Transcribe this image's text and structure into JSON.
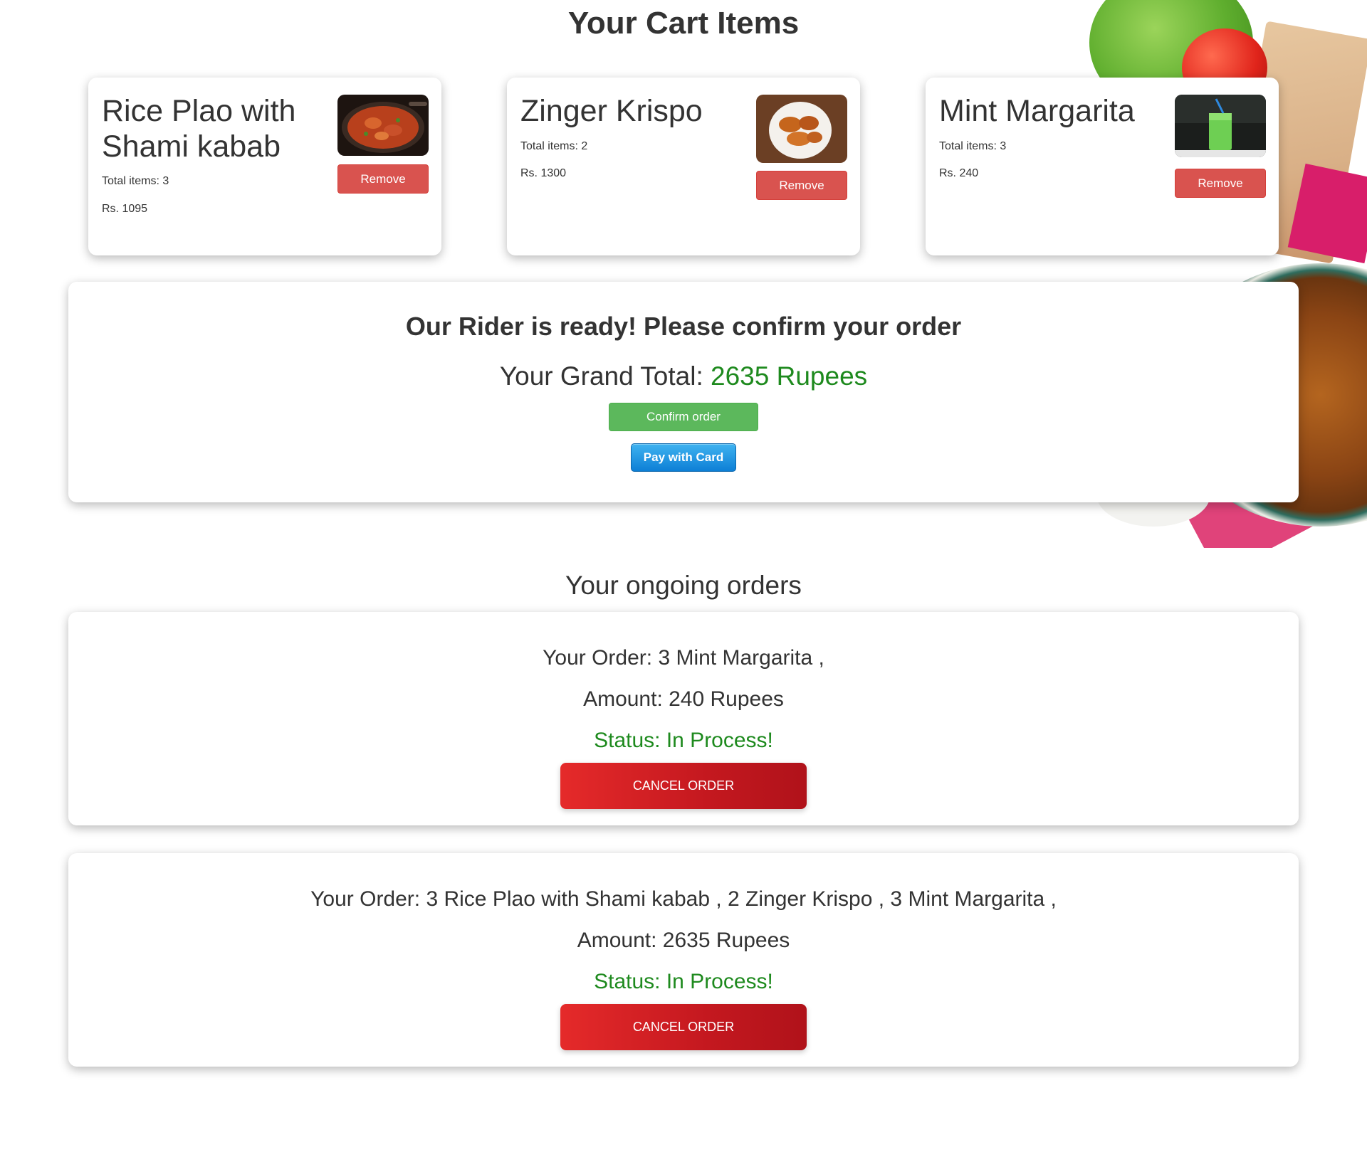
{
  "cart": {
    "title": "Your Cart Items",
    "items": [
      {
        "name": "Rice Plao with Shami kabab",
        "total_items": "Total items: 3",
        "price": "Rs. 1095",
        "remove_label": "Remove",
        "image_icon": "food-photo-curry"
      },
      {
        "name": "Zinger Krispo",
        "total_items": "Total items: 2",
        "price": "Rs. 1300",
        "remove_label": "Remove",
        "image_icon": "food-photo-fried-chicken"
      },
      {
        "name": "Mint Margarita",
        "total_items": "Total items: 3",
        "price": "Rs. 240",
        "remove_label": "Remove",
        "image_icon": "food-photo-green-drink"
      }
    ]
  },
  "confirm": {
    "heading": "Our Rider is ready! Please confirm your order",
    "grand_total_label": "Your Grand Total: ",
    "grand_total_amount": "2635 Rupees",
    "confirm_label": "Confirm order",
    "pay_label": "Pay with Card"
  },
  "ongoing": {
    "title": "Your ongoing orders",
    "orders": [
      {
        "order_text": "Your Order: 3 Mint Margarita ,",
        "amount_text": "Amount: 240 Rupees",
        "status_text": "Status: In Process!",
        "cancel_label": "CANCEL ORDER"
      },
      {
        "order_text": "Your Order: 3 Rice Plao with Shami kabab , 2 Zinger Krispo , 3 Mint Margarita ,",
        "amount_text": "Amount: 2635 Rupees",
        "status_text": "Status: In Process!",
        "cancel_label": "CANCEL ORDER"
      }
    ]
  },
  "colors": {
    "remove": "#d9534f",
    "confirm": "#5cb85c",
    "pay": "#1a8fe3",
    "cancel": "#d41f24",
    "status": "#1e8a1e"
  }
}
